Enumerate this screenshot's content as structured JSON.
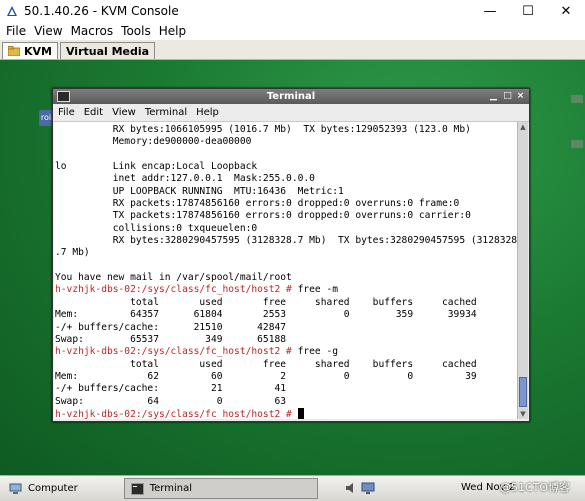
{
  "window": {
    "title": "50.1.40.26 - KVM Console",
    "controls": {
      "minimize": "—",
      "maximize": "☐",
      "close": "✕"
    }
  },
  "menubar": [
    "File",
    "View",
    "Macros",
    "Tools",
    "Help"
  ],
  "tabs": [
    "KVM",
    "Virtual Media"
  ],
  "terminal": {
    "title": "Terminal",
    "menu": [
      "File",
      "Edit",
      "View",
      "Terminal",
      "Help"
    ],
    "lines": [
      {
        "text": "          RX bytes:1066105995 (1016.7 Mb)  TX bytes:129052393 (123.0 Mb)",
        "prompt": false
      },
      {
        "text": "          Memory:de900000-dea00000",
        "prompt": false
      },
      {
        "text": "",
        "prompt": false
      },
      {
        "text": "lo        Link encap:Local Loopback",
        "prompt": false
      },
      {
        "text": "          inet addr:127.0.0.1  Mask:255.0.0.0",
        "prompt": false
      },
      {
        "text": "          UP LOOPBACK RUNNING  MTU:16436  Metric:1",
        "prompt": false
      },
      {
        "text": "          RX packets:17874856160 errors:0 dropped:0 overruns:0 frame:0",
        "prompt": false
      },
      {
        "text": "          TX packets:17874856160 errors:0 dropped:0 overruns:0 carrier:0",
        "prompt": false
      },
      {
        "text": "          collisions:0 txqueuelen:0",
        "prompt": false
      },
      {
        "text": "          RX bytes:3280290457595 (3128328.7 Mb)  TX bytes:3280290457595 (3128328",
        "prompt": false
      },
      {
        "text": ".7 Mb)",
        "prompt": false
      },
      {
        "text": "",
        "prompt": false
      },
      {
        "text": "You have new mail in /var/spool/mail/root",
        "prompt": false
      },
      {
        "text": "h-vzhjk-dbs-02:/sys/class/fc_host/host2 #",
        "prompt": true,
        "cmd": " free -m"
      },
      {
        "text": "             total       used       free     shared    buffers     cached",
        "prompt": false
      },
      {
        "text": "Mem:         64357      61804       2553          0        359      39934",
        "prompt": false
      },
      {
        "text": "-/+ buffers/cache:      21510      42847",
        "prompt": false
      },
      {
        "text": "Swap:        65537        349      65188",
        "prompt": false
      },
      {
        "text": "h-vzhjk-dbs-02:/sys/class/fc_host/host2 #",
        "prompt": true,
        "cmd": " free -g"
      },
      {
        "text": "             total       used       free     shared    buffers     cached",
        "prompt": false
      },
      {
        "text": "Mem:            62         60          2          0          0         39",
        "prompt": false
      },
      {
        "text": "-/+ buffers/cache:         21         41",
        "prompt": false
      },
      {
        "text": "Swap:           64          0         63",
        "prompt": false
      },
      {
        "text": "h-vzhjk-dbs-02:/sys/class/fc_host/host2 #",
        "prompt": true,
        "cmd": " ",
        "cursor": true
      }
    ]
  },
  "desktop": {
    "icon_label": "roi"
  },
  "taskbar": {
    "items": [
      "Computer",
      "Terminal"
    ],
    "clock": "Wed Nov 2",
    "watermark": "@51CTO博客"
  }
}
